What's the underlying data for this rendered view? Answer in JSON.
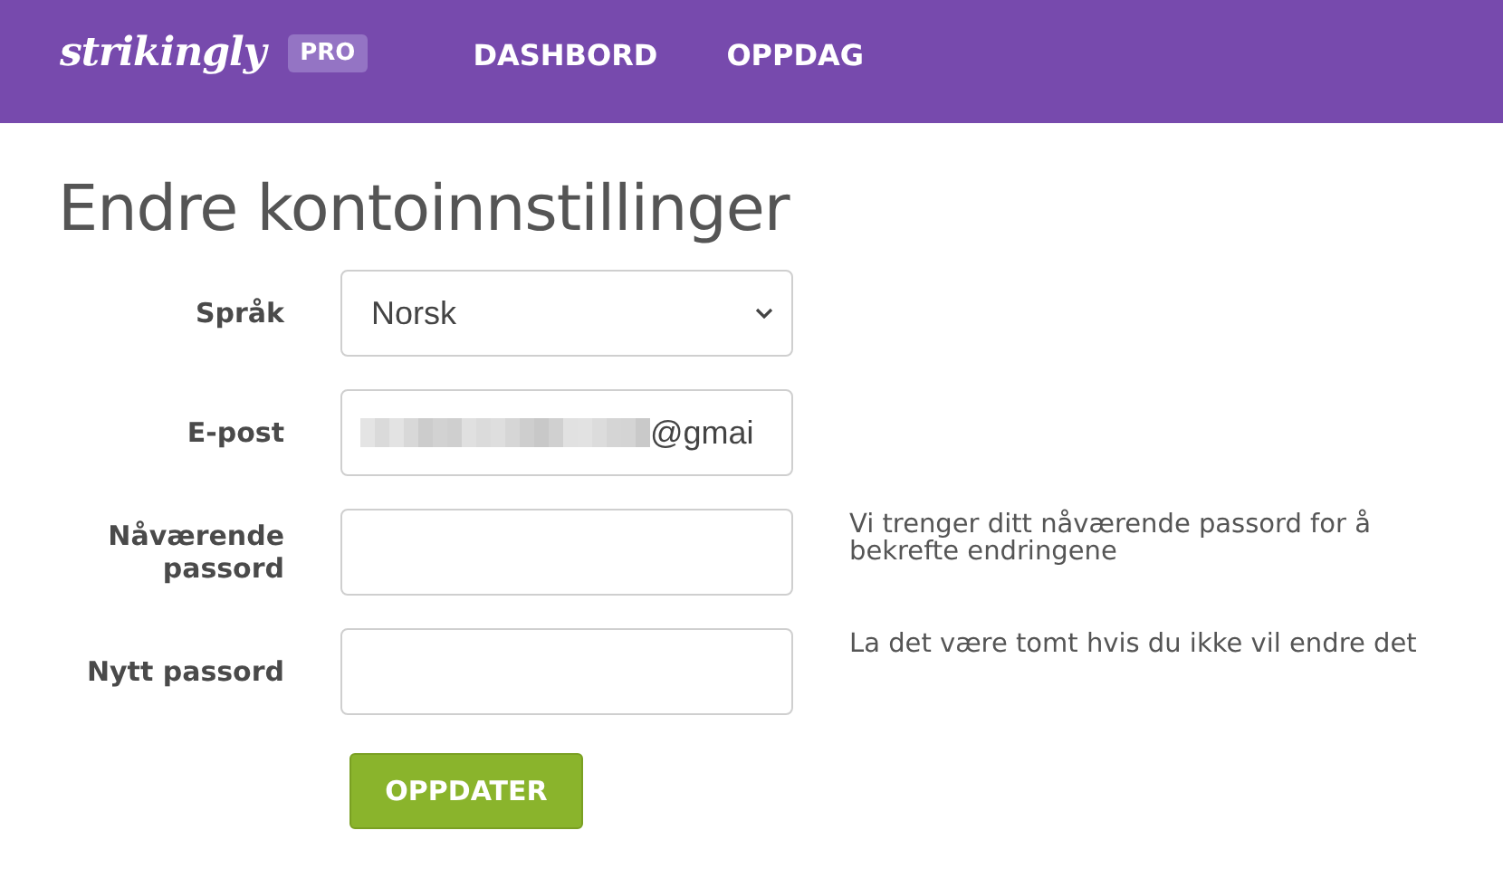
{
  "header": {
    "logo": "strikingly",
    "badge": "PRO",
    "nav": [
      {
        "label": "DASHBORD"
      },
      {
        "label": "OPPDAG"
      }
    ]
  },
  "title": "Endre kontoinnstillinger",
  "form": [
    {
      "label": "Språk",
      "kind": "select",
      "value": "Norsk"
    },
    {
      "label": "E-post",
      "kind": "email",
      "value": "@gmai",
      "redacted": true
    },
    {
      "label": "Nåværende passord",
      "kind": "password",
      "help": "Vi trenger ditt nåværende passord for å bekrefte endringene"
    },
    {
      "label": "Nytt passord",
      "kind": "password",
      "help": "La det være tomt hvis du ikke vil endre det"
    }
  ],
  "submit": "OPPDATER"
}
